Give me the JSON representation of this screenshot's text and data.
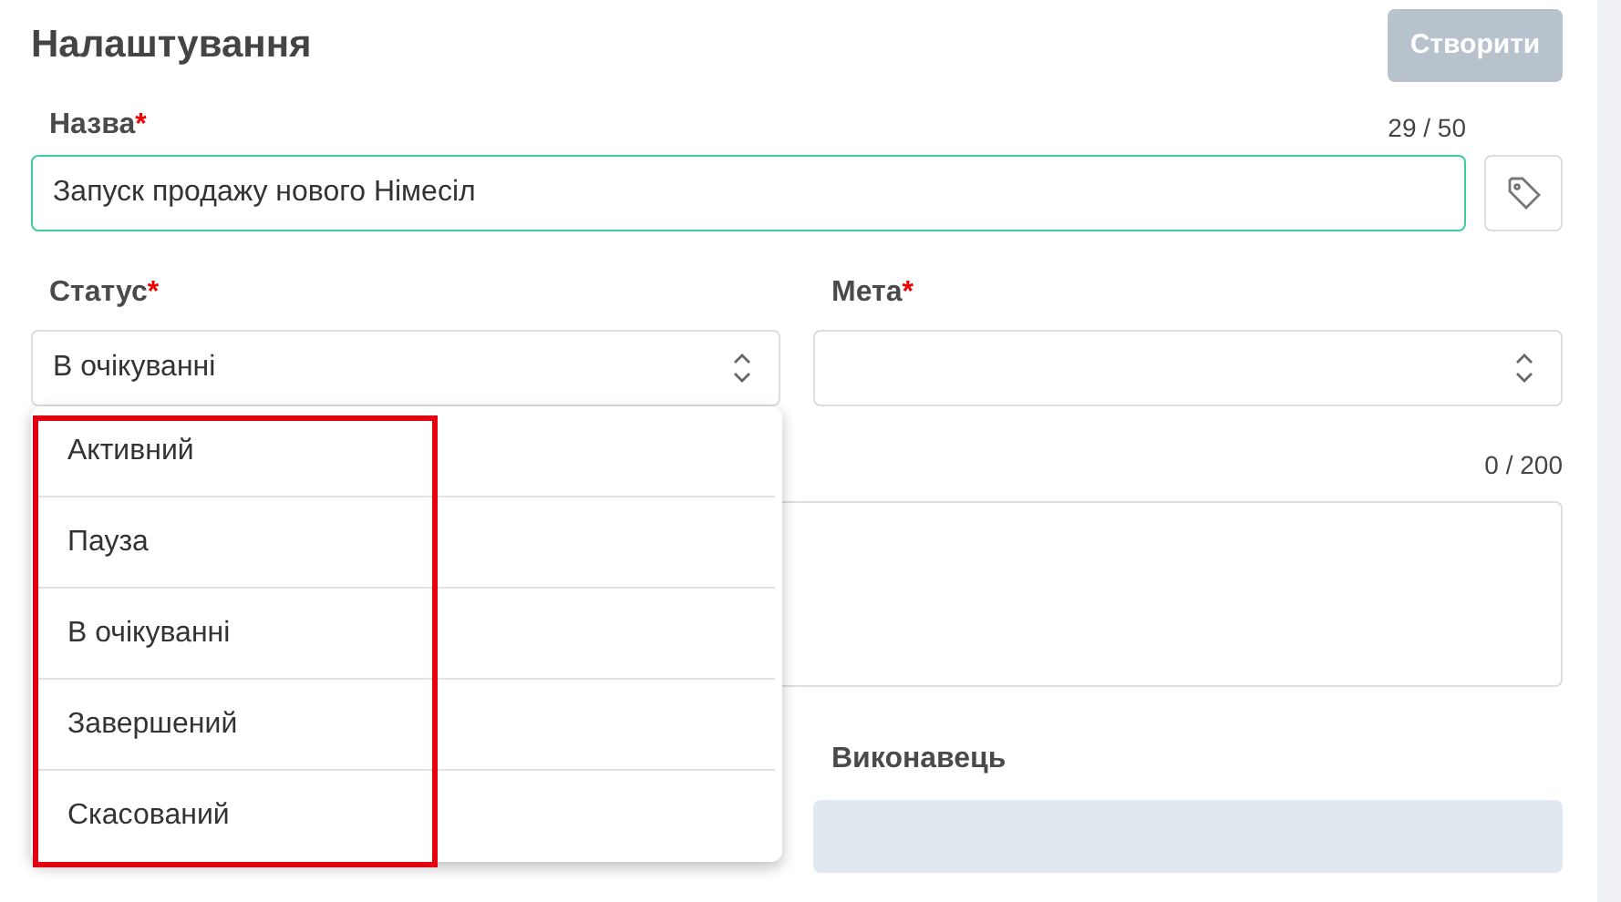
{
  "title": "Налаштування",
  "create_button": {
    "label": "Створити",
    "disabled": true
  },
  "name_field": {
    "label": "Назва",
    "required_mark": "*",
    "counter": "29 / 50",
    "value": "Запуск продажу нового Німесіл"
  },
  "status_field": {
    "label": "Статус",
    "required_mark": "*",
    "value": "В очікуванні"
  },
  "goal_field": {
    "label": "Мета",
    "required_mark": "*"
  },
  "description_field": {
    "counter": "0 / 200"
  },
  "assignee_field": {
    "label": "Виконавець"
  },
  "status_dropdown": {
    "options": [
      {
        "label": "Активний"
      },
      {
        "label": "Пауза"
      },
      {
        "label": "В очікуванні"
      },
      {
        "label": "Завершений"
      },
      {
        "label": "Скасований"
      }
    ]
  }
}
